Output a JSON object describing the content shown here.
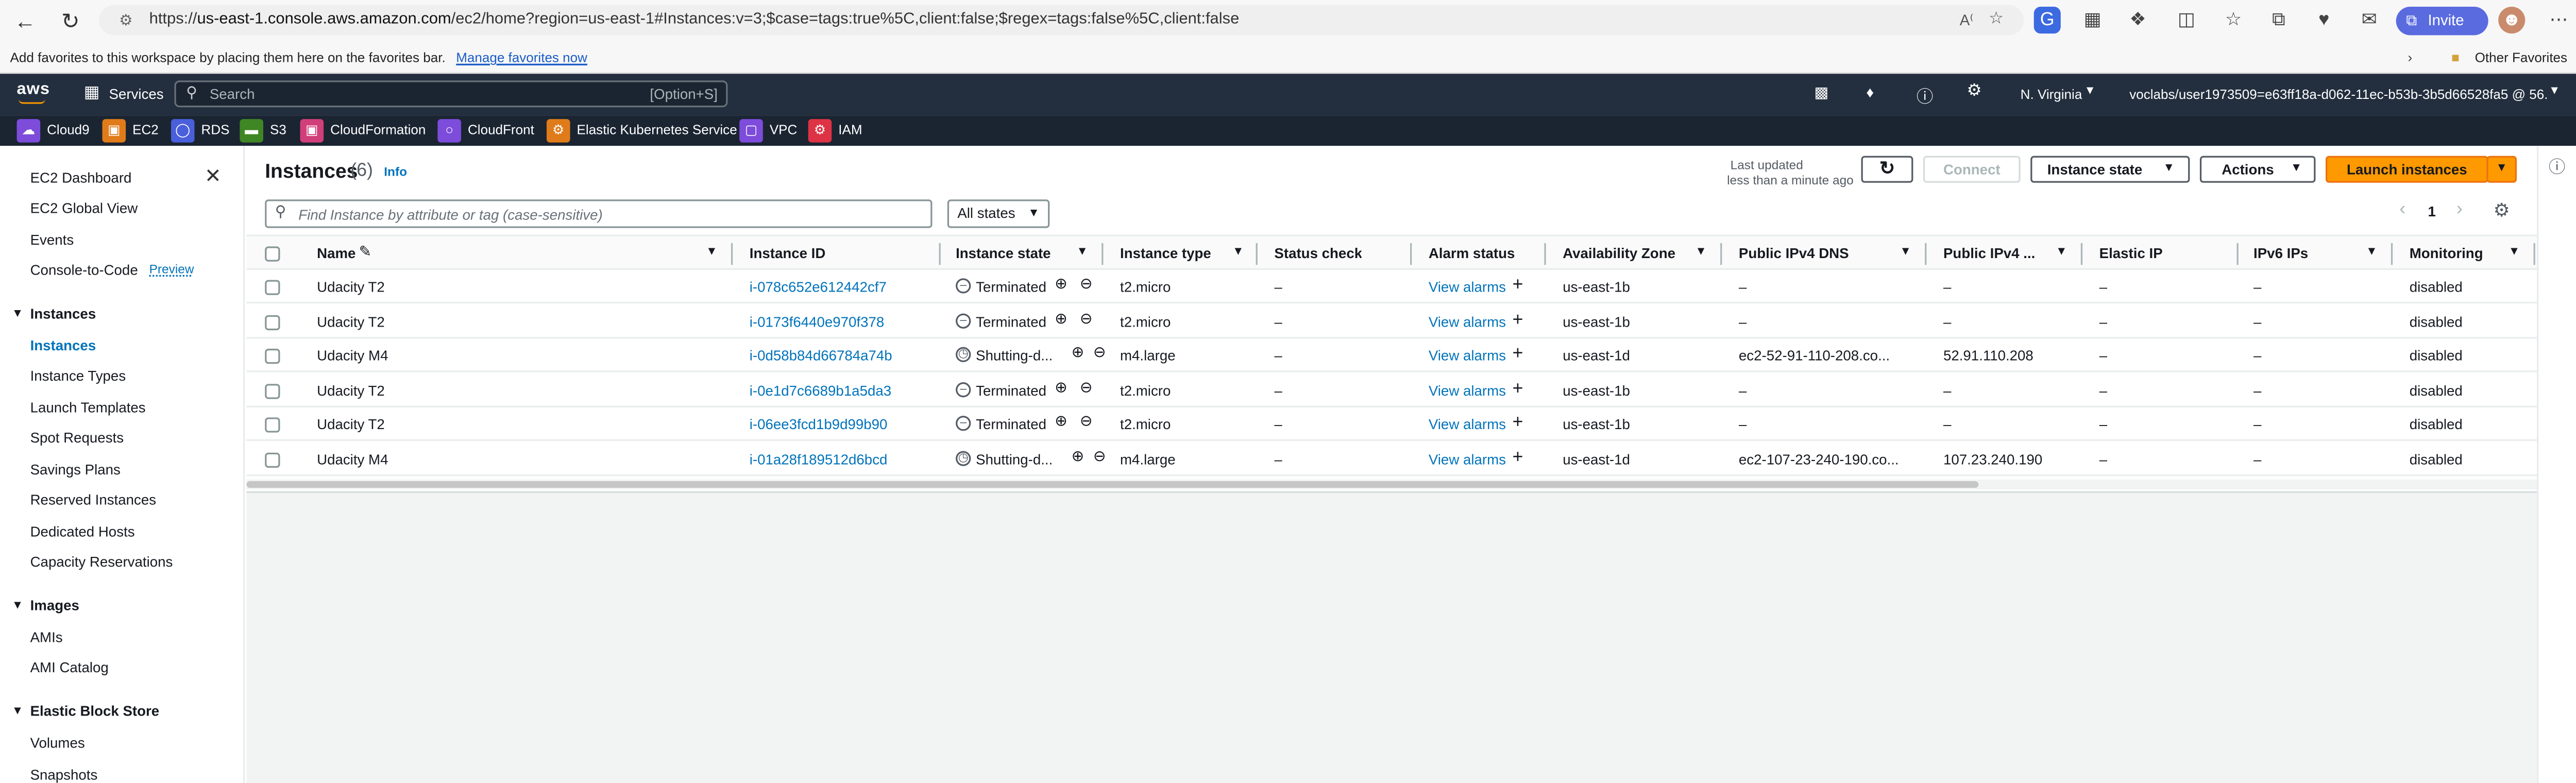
{
  "browser": {
    "url_prefix": "https://",
    "url_domain": "us-east-1.console.aws.amazon.com",
    "url_rest": "/ec2/home?region=us-east-1#Instances:v=3;$case=tags:true%5C,client:false;$regex=tags:false%5C,client:false",
    "invite_label": "Invite",
    "favbar_text": "Add favorites to this workspace by placing them here on the favorites bar.",
    "manage_favorites": "Manage favorites now",
    "other_favorites": "Other Favorites"
  },
  "aws": {
    "logo": "aws",
    "services_label": "Services",
    "search_placeholder": "Search",
    "search_shortcut": "[Option+S]",
    "region": "N. Virginia",
    "account": "voclabs/user1973509=e63ff18a-d062-11ec-b53b-3b5d66528fa5 @ 56..."
  },
  "service_shortcuts": [
    {
      "label": "Cloud9",
      "color": "#7d4cdb"
    },
    {
      "label": "EC2",
      "color": "#e07b1a"
    },
    {
      "label": "RDS",
      "color": "#4a5fdb"
    },
    {
      "label": "S3",
      "color": "#3f8624"
    },
    {
      "label": "CloudFormation",
      "color": "#d13f7a"
    },
    {
      "label": "CloudFront",
      "color": "#7d4cdb"
    },
    {
      "label": "Elastic Kubernetes Service",
      "color": "#e07b1a"
    },
    {
      "label": "VPC",
      "color": "#7d4cdb"
    },
    {
      "label": "IAM",
      "color": "#dd3344"
    }
  ],
  "leftnav": {
    "dashboard": "EC2 Dashboard",
    "global_view": "EC2 Global View",
    "events": "Events",
    "console_to_code": "Console-to-Code",
    "preview": "Preview",
    "sections": [
      {
        "title": "Instances",
        "items": [
          "Instances",
          "Instance Types",
          "Launch Templates",
          "Spot Requests",
          "Savings Plans",
          "Reserved Instances",
          "Dedicated Hosts",
          "Capacity Reservations"
        ]
      },
      {
        "title": "Images",
        "items": [
          "AMIs",
          "AMI Catalog"
        ]
      },
      {
        "title": "Elastic Block Store",
        "items": [
          "Volumes",
          "Snapshots"
        ]
      }
    ]
  },
  "main": {
    "title": "Instances",
    "count": "(6)",
    "info": "Info",
    "last_updated_label": "Last updated",
    "last_updated_value": "less than a minute ago",
    "connect_label": "Connect",
    "instance_state_label": "Instance state",
    "actions_label": "Actions",
    "launch_label": "Launch instances",
    "filter_placeholder": "Find Instance by attribute or tag (case-sensitive)",
    "states_filter": "All states",
    "page_number": "1"
  },
  "table": {
    "columns": [
      "Name",
      "Instance ID",
      "Instance state",
      "Instance type",
      "Status check",
      "Alarm status",
      "Availability Zone",
      "Public IPv4 DNS",
      "Public IPv4 ...",
      "Elastic IP",
      "IPv6 IPs",
      "Monitoring"
    ],
    "rows": [
      {
        "name": "Udacity T2",
        "id": "i-078c652e612442cf7",
        "state": "Terminated",
        "type": "t2.micro",
        "status": "–",
        "alarm": "View alarms",
        "az": "us-east-1b",
        "dns": "–",
        "ipv4": "–",
        "eip": "–",
        "ipv6": "–",
        "monitoring": "disabled"
      },
      {
        "name": "Udacity T2",
        "id": "i-0173f6440e970f378",
        "state": "Terminated",
        "type": "t2.micro",
        "status": "–",
        "alarm": "View alarms",
        "az": "us-east-1b",
        "dns": "–",
        "ipv4": "–",
        "eip": "–",
        "ipv6": "–",
        "monitoring": "disabled"
      },
      {
        "name": "Udacity M4",
        "id": "i-0d58b84d66784a74b",
        "state": "Shutting-d...",
        "type": "m4.large",
        "status": "–",
        "alarm": "View alarms",
        "az": "us-east-1d",
        "dns": "ec2-52-91-110-208.co...",
        "ipv4": "52.91.110.208",
        "eip": "–",
        "ipv6": "–",
        "monitoring": "disabled"
      },
      {
        "name": "Udacity T2",
        "id": "i-0e1d7c6689b1a5da3",
        "state": "Terminated",
        "type": "t2.micro",
        "status": "–",
        "alarm": "View alarms",
        "az": "us-east-1b",
        "dns": "–",
        "ipv4": "–",
        "eip": "–",
        "ipv6": "–",
        "monitoring": "disabled"
      },
      {
        "name": "Udacity T2",
        "id": "i-06ee3fcd1b9d99b90",
        "state": "Terminated",
        "type": "t2.micro",
        "status": "–",
        "alarm": "View alarms",
        "az": "us-east-1b",
        "dns": "–",
        "ipv4": "–",
        "eip": "–",
        "ipv6": "–",
        "monitoring": "disabled"
      },
      {
        "name": "Udacity M4",
        "id": "i-01a28f189512d6bcd",
        "state": "Shutting-d...",
        "type": "m4.large",
        "status": "–",
        "alarm": "View alarms",
        "az": "us-east-1d",
        "dns": "ec2-107-23-240-190.co...",
        "ipv4": "107.23.240.190",
        "eip": "–",
        "ipv6": "–",
        "monitoring": "disabled"
      }
    ]
  },
  "colors": {
    "accent": "#ff9900",
    "link": "#0073bb",
    "header": "#232f3e"
  }
}
